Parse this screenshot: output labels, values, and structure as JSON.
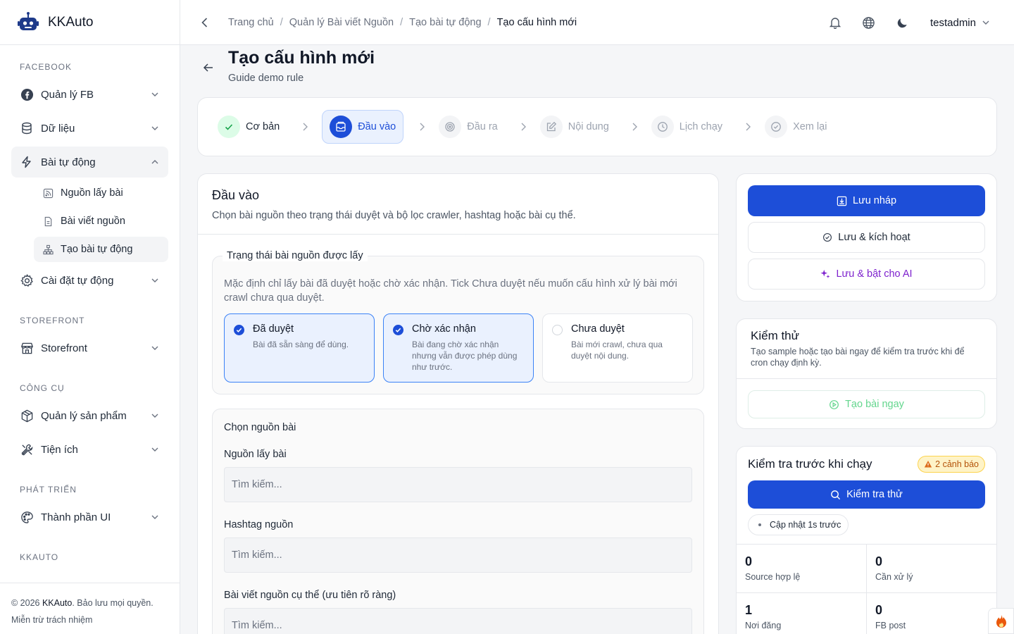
{
  "brand": {
    "name": "KKAuto"
  },
  "sidebar": {
    "sections": [
      {
        "title": "FACEBOOK"
      },
      {
        "title": "STOREFRONT"
      },
      {
        "title": "CÔNG CỤ"
      },
      {
        "title": "PHÁT TRIỂN"
      },
      {
        "title": "KKAUTO"
      }
    ],
    "items": {
      "fb": "Quản lý FB",
      "data": "Dữ liệu",
      "auto_posts": "Bài tự động",
      "sub_sources": "Nguồn lấy bài",
      "sub_source_posts": "Bài viết nguồn",
      "sub_create": "Tạo bài tự động",
      "auto_settings": "Cài đặt tự động",
      "storefront": "Storefront",
      "products": "Quản lý sản phẩm",
      "utilities": "Tiện ích",
      "ui_components": "Thành phần UI"
    },
    "footer": {
      "copyright_prefix": "© 2026 ",
      "copyright_brand": "KKAuto",
      "copyright_suffix": ". Bảo lưu mọi quyền.",
      "disclaimer": "Miễn trừ trách nhiệm"
    }
  },
  "header": {
    "breadcrumb": [
      "Trang chủ",
      "Quản lý Bài viết Nguồn",
      "Tạo bài tự động",
      "Tạo cấu hình mới"
    ],
    "user": "testadmin"
  },
  "page": {
    "title": "Tạo cấu hình mới",
    "subtitle": "Guide demo rule"
  },
  "stepper": [
    "Cơ bản",
    "Đầu vào",
    "Đầu ra",
    "Nội dung",
    "Lịch chạy",
    "Xem lại"
  ],
  "main": {
    "title": "Đầu vào",
    "description": "Chọn bài nguồn theo trạng thái duyệt và bộ lọc crawler, hashtag hoặc bài cụ thể.",
    "status_group": {
      "legend": "Trạng thái bài nguồn được lấy",
      "description": "Mặc định chỉ lấy bài đã duyệt hoặc chờ xác nhận. Tick Chưa duyệt nếu muốn cấu hình xử lý bài mới crawl chưa qua duyệt.",
      "options": [
        {
          "title": "Đã duyệt",
          "desc": "Bài đã sẵn sàng để dùng.",
          "checked": true
        },
        {
          "title": "Chờ xác nhận",
          "desc": "Bài đang chờ xác nhận nhưng vẫn được phép dùng như trước.",
          "checked": true
        },
        {
          "title": "Chưa duyệt",
          "desc": "Bài mới crawl, chưa qua duyệt nội dung.",
          "checked": false
        }
      ]
    },
    "source": {
      "title": "Chọn nguồn bài",
      "fields": [
        {
          "label": "Nguồn lấy bài",
          "placeholder": "Tìm kiếm..."
        },
        {
          "label": "Hashtag nguồn",
          "placeholder": "Tìm kiếm..."
        },
        {
          "label": "Bài viết nguồn cụ thể (ưu tiên rõ ràng)",
          "placeholder": "Tìm kiếm..."
        }
      ]
    }
  },
  "actions": {
    "save_draft": "Lưu nháp",
    "save_activate": "Lưu & kích hoạt",
    "save_ai": "Lưu & bật cho AI"
  },
  "test": {
    "title": "Kiểm thử",
    "description": "Tạo sample hoặc tạo bài ngay để kiểm tra trước khi để cron chạy định kỳ.",
    "button": "Tạo bài ngay"
  },
  "precheck": {
    "title": "Kiểm tra trước khi chạy",
    "warning_badge": "2 cảnh báo",
    "button": "Kiểm tra thử",
    "updated": "Cập nhật 1s trước",
    "stats": [
      {
        "value": "0",
        "label": "Source hợp lệ"
      },
      {
        "value": "0",
        "label": "Cần xử lý"
      },
      {
        "value": "1",
        "label": "Nơi đăng"
      },
      {
        "value": "0",
        "label": "FB post"
      }
    ]
  },
  "colors": {
    "primary": "#1d4ed8",
    "ai": "#7e22ce",
    "success": "#22c55e",
    "warning": "#b45309"
  }
}
